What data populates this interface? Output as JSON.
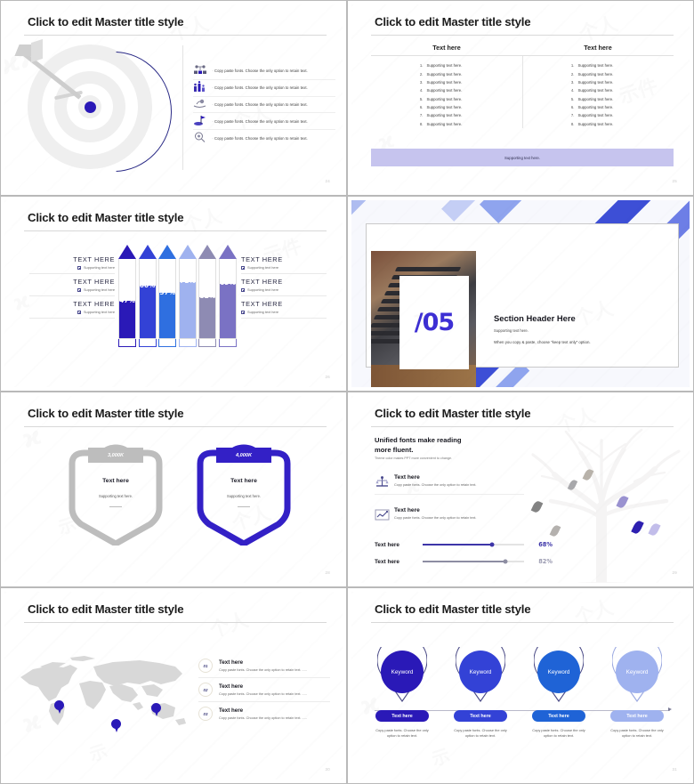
{
  "common": {
    "title": "Click to edit Master title style",
    "text_here": "Text here",
    "supporting": "Supporting text here.",
    "copy_paste": "Copy paste fonts. Choose the only option to retain text.",
    "colors": {
      "deep_indigo": "#2a19b7",
      "royal_blue": "#3342d6",
      "bright_blue": "#2f6fe0",
      "periwinkle": "#9fb2ef",
      "gray_purple": "#8e8bb3",
      "medium_purple": "#7a72c4",
      "band_lavender": "#c6c4ee",
      "gray": "#bdbdbd"
    }
  },
  "slides": [
    {
      "id": "target-list",
      "title": "Click to edit Master title style",
      "page": "24",
      "items": [
        {
          "icon": "network-icon",
          "bullet": "·",
          "text": "Copy paste fonts. Choose the only option to retain text."
        },
        {
          "icon": "bar-people-icon",
          "bullet": "·",
          "text": "Copy paste fonts. Choose the only option to retain text."
        },
        {
          "icon": "hand-care-icon",
          "bullet": "·",
          "text": "Copy paste fonts. Choose the only option to retain text."
        },
        {
          "icon": "flag-icon",
          "bullet": "·",
          "text": "Copy paste fonts. Choose the only option to retain text."
        },
        {
          "icon": "search-icon",
          "bullet": "·",
          "text": "Copy paste fonts. Choose the only option to retain text."
        }
      ]
    },
    {
      "id": "two-column-table",
      "title": "Click to edit Master title style",
      "page": "25",
      "headers": [
        "Text here",
        "Text here"
      ],
      "left_items": [
        "Supporting text here.",
        "Supporting text here.",
        "Supporting text here.",
        "Supporting text here.",
        "Supporting text here.",
        "Supporting text here.",
        "Supporting text here.",
        "Supporting text here."
      ],
      "right_items": [
        "Supporting text here.",
        "Supporting text here.",
        "Supporting text here.",
        "Supporting text here.",
        "Supporting text here.",
        "Supporting text here.",
        "Supporting text here.",
        "Supporting text here."
      ],
      "footer_band": "Supporting text here."
    },
    {
      "id": "arrow-bars",
      "title": "Click to edit Master title style",
      "page": "26",
      "left_labels": [
        {
          "heading": "TEXT HERE",
          "sub": "Supporting text here"
        },
        {
          "heading": "TEXT HERE",
          "sub": "Supporting text here"
        },
        {
          "heading": "TEXT HERE",
          "sub": "Supporting text here"
        }
      ],
      "right_labels": [
        {
          "heading": "TEXT HERE",
          "sub": "Supporting text here"
        },
        {
          "heading": "TEXT HERE",
          "sub": "Supporting text here"
        },
        {
          "heading": "TEXT HERE",
          "sub": "Supporting text here"
        }
      ],
      "chart_data": {
        "type": "bar",
        "title": "",
        "categories": [
          "1",
          "2",
          "3",
          "4",
          "5",
          "6"
        ],
        "values": [
          47,
          66,
          57,
          71,
          52,
          69
        ],
        "labels": [
          "47%",
          "66%",
          "57%",
          "71%",
          "52%",
          "69%"
        ],
        "colors": [
          "#2a19b7",
          "#3342d6",
          "#2f6fe0",
          "#9fb2ef",
          "#8e8bb3",
          "#7a72c4"
        ],
        "ylim": [
          0,
          100
        ],
        "xlabel": "",
        "ylabel": ""
      }
    },
    {
      "id": "section-header",
      "title": "",
      "page": "",
      "number": "/05",
      "heading": "Section Header Here",
      "sub": "Supporting text here.",
      "note": "When you copy & paste, choose “keep text only” option."
    },
    {
      "id": "shield-compare",
      "title": "Click to edit Master title style",
      "page": "28",
      "shields": [
        {
          "value": "3,000K",
          "heading": "Text here",
          "sub": "Supporting text here.",
          "color": "#bdbdbd"
        },
        {
          "value": "4,000K",
          "heading": "Text here",
          "sub": "Supporting text here.",
          "color": "#3320c6"
        }
      ]
    },
    {
      "id": "tree-progress",
      "title": "Click to edit Master title style",
      "page": "29",
      "heading_line1": "Unified fonts make reading",
      "heading_line2": "more fluent.",
      "subtitle": "Theme color makes PPT more convenient to change.",
      "rows": [
        {
          "icon": "scale-icon",
          "heading": "Text here",
          "text": "Copy paste fonts. Choose the only option to retain text."
        },
        {
          "icon": "chart-icon",
          "heading": "Text here",
          "text": "Copy paste fonts. Choose the only option to retain text."
        }
      ],
      "chart_data": {
        "type": "bar",
        "title": "",
        "categories": [
          "Text here",
          "Text here"
        ],
        "values": [
          68,
          82
        ],
        "labels": [
          "68%",
          "82%"
        ],
        "colors": [
          "#3d35a8",
          "#8d8da2"
        ],
        "ylim": [
          0,
          100
        ],
        "xlabel": "",
        "ylabel": ""
      }
    },
    {
      "id": "world-map",
      "title": "Click to edit Master title style",
      "page": "30",
      "rows": [
        {
          "num": "01",
          "heading": "Text here",
          "text": "Copy paste fonts. Choose the only option to retain text. ....."
        },
        {
          "num": "02",
          "heading": "Text here",
          "text": "Copy paste fonts. Choose the only option to retain text. ....."
        },
        {
          "num": "03",
          "heading": "Text here",
          "text": "Copy paste fonts. Choose the only option to retain text. ....."
        }
      ]
    },
    {
      "id": "keyword-timeline",
      "title": "Click to edit Master title style",
      "page": "31",
      "items": [
        {
          "keyword": "Keyword",
          "button": "Text here",
          "desc": "Copy paste fonts. Choose the only option to retain text.",
          "color": "#2a19b7"
        },
        {
          "keyword": "Keyword",
          "button": "Text here",
          "desc": "Copy paste fonts. Choose the only option to retain text.",
          "color": "#3342d6"
        },
        {
          "keyword": "Keyword",
          "button": "Text here",
          "desc": "Copy paste fonts. Choose the only option to retain text.",
          "color": "#1f63d6"
        },
        {
          "keyword": "Keyword",
          "button": "Text here",
          "desc": "Copy paste fonts. Choose the only option to retain text.",
          "color": "#9fb2ef"
        }
      ]
    }
  ]
}
